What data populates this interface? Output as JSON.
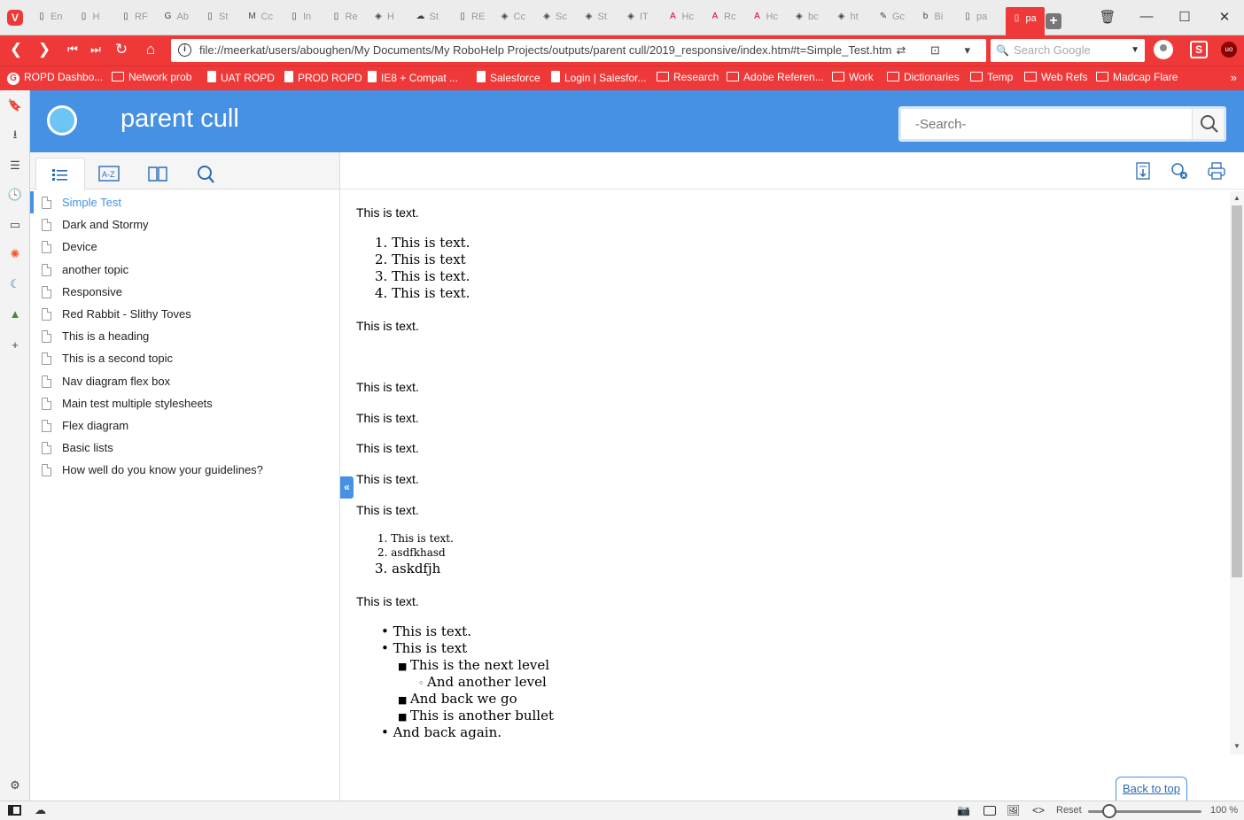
{
  "tabs": [
    {
      "icon": "file-icon",
      "label": "En"
    },
    {
      "icon": "file-icon",
      "label": "H"
    },
    {
      "icon": "file-icon",
      "label": "RF"
    },
    {
      "icon": "google-icon",
      "label": "Ab"
    },
    {
      "icon": "file-icon",
      "label": "St"
    },
    {
      "icon": "medium-icon",
      "label": "Cc"
    },
    {
      "icon": "file-icon",
      "label": "In"
    },
    {
      "icon": "file-icon",
      "label": "Re"
    },
    {
      "icon": "web-icon",
      "label": "H"
    },
    {
      "icon": "cloud-icon",
      "label": "St"
    },
    {
      "icon": "file-icon",
      "label": "RE"
    },
    {
      "icon": "web-icon",
      "label": "Cc"
    },
    {
      "icon": "web-icon",
      "label": "Sc"
    },
    {
      "icon": "web-icon",
      "label": "St"
    },
    {
      "icon": "web-icon",
      "label": "IT"
    },
    {
      "icon": "adobe-icon",
      "label": "Hc"
    },
    {
      "icon": "adobe-icon",
      "label": "Rc"
    },
    {
      "icon": "adobe-icon",
      "label": "Hc"
    },
    {
      "icon": "web-icon",
      "label": "bc"
    },
    {
      "icon": "web-icon",
      "label": "ht"
    },
    {
      "icon": "translate-icon",
      "label": "Gc"
    },
    {
      "icon": "bing-icon",
      "label": "Bi"
    },
    {
      "icon": "file-icon",
      "label": "pa"
    },
    {
      "icon": "file-icon",
      "label": "pa",
      "active": true
    }
  ],
  "address_bar": {
    "url": "file://meerkat/users/aboughen/My Documents/My RoboHelp Projects/outputs/parent cull/2019_responsive/index.htm#t=Simple_Test.htm",
    "search_placeholder": "Search Google"
  },
  "bookmarks": [
    {
      "label": "ROPD Dashbo...",
      "type": "google"
    },
    {
      "label": "Network prob",
      "type": "folder"
    },
    {
      "label": "UAT ROPD",
      "type": "page"
    },
    {
      "label": "PROD ROPD",
      "type": "page"
    },
    {
      "label": "IE8 + Compat ...",
      "type": "page"
    },
    {
      "label": "Salesforce",
      "type": "page"
    },
    {
      "label": "Login | Salesfor...",
      "type": "page"
    },
    {
      "label": "Research",
      "type": "folder"
    },
    {
      "label": "Adobe Referen...",
      "type": "folder"
    },
    {
      "label": "Work",
      "type": "folder"
    },
    {
      "label": "Dictionaries",
      "type": "folder"
    },
    {
      "label": "Temp",
      "type": "folder"
    },
    {
      "label": "Web Refs",
      "type": "folder"
    },
    {
      "label": "Madcap Flare",
      "type": "folder"
    }
  ],
  "help": {
    "title": "parent cull",
    "search_placeholder": "-Search-"
  },
  "toc": [
    "Simple Test",
    "Dark and Stormy",
    "Device",
    "another topic",
    "Responsive",
    "Red Rabbit - Slithy Toves",
    "This is a heading",
    "This is a second topic",
    "Nav diagram flex box",
    "Main test multiple stylesheets",
    "Flex diagram",
    "Basic lists",
    "How well do you know your guidelines?"
  ],
  "content": {
    "p1": "This is text.",
    "ol1": [
      "This is text.",
      "This is text",
      "This is text.",
      "This is text."
    ],
    "p2": "This is text.",
    "p3": "This is text.",
    "p4": "This is text.",
    "p5": "This is text.",
    "p6": "This is text.",
    "p7": "This is text.",
    "ol2": [
      "This is text.",
      "asdfkhasd",
      "askdfjh"
    ],
    "p8": "This is text.",
    "ul": {
      "l1a": "This is text.",
      "l1b": "This is text",
      "l2a": "This is the next level",
      "l3a": "And another level",
      "l2b": "And back we go",
      "l2c": "This is another bullet",
      "l1c": "And back again."
    },
    "back_to_top": "Back to top"
  },
  "status_bar": {
    "reset": "Reset",
    "zoom": "100 %"
  },
  "colors": {
    "browser_red": "#ef3939",
    "help_blue": "#4691e3"
  }
}
